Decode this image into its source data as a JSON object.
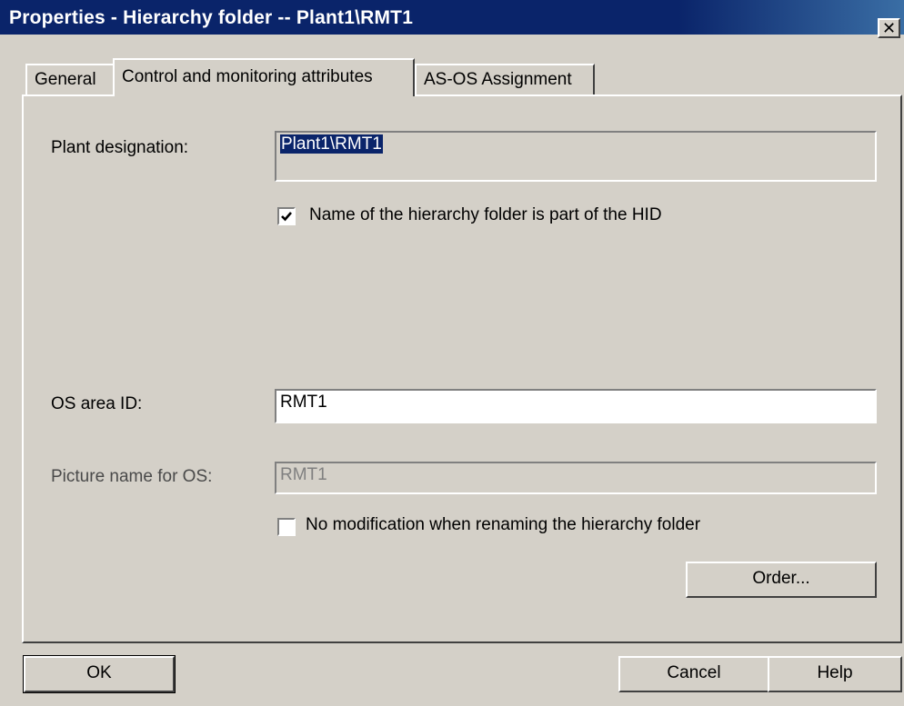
{
  "window": {
    "title": "Properties - Hierarchy folder -- Plant1\\RMT1",
    "close_glyph": "✕"
  },
  "tabs": [
    {
      "label": "General",
      "active": false
    },
    {
      "label": "Control and monitoring attributes",
      "active": true
    },
    {
      "label": "AS-OS Assignment",
      "active": false
    }
  ],
  "form": {
    "plant_designation_label": "Plant designation:",
    "plant_designation_value": "Plant1\\RMT1",
    "hid_checkbox_label": "Name of the hierarchy folder is part of the HID",
    "hid_checkbox_checked": true,
    "os_area_label": "OS area ID:",
    "os_area_value": "RMT1",
    "picture_name_label": "Picture name for OS:",
    "picture_name_value": "RMT1",
    "no_mod_checkbox_label": "No modification when renaming the hierarchy folder",
    "no_mod_checkbox_checked": false,
    "order_button": "Order..."
  },
  "buttons": {
    "ok": "OK",
    "cancel": "Cancel",
    "help": "Help"
  },
  "icons": [
    "close-icon",
    "checkmark-icon"
  ]
}
